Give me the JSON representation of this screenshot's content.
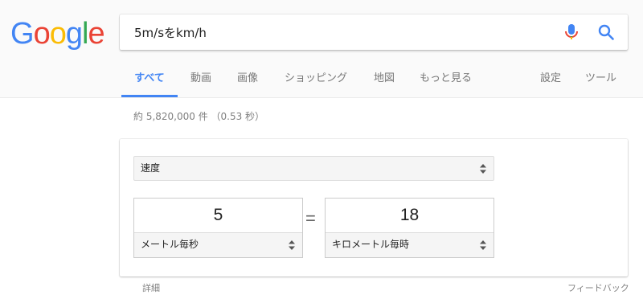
{
  "logo": {
    "text": "Google",
    "letters": [
      "G",
      "o",
      "o",
      "g",
      "l",
      "e"
    ],
    "colors": [
      "#4285f4",
      "#ea4335",
      "#fbbc05",
      "#4285f4",
      "#34a853",
      "#ea4335"
    ]
  },
  "search": {
    "query": "5m/sをkm/h",
    "mic_icon": "microphone-icon",
    "search_icon": "magnifier-icon"
  },
  "tabs": {
    "all": "すべて",
    "videos": "動画",
    "images": "画像",
    "shopping": "ショッピング",
    "maps": "地図",
    "more": "もっと見る",
    "settings": "設定",
    "tools": "ツール"
  },
  "result_stats": "約 5,820,000 件 （0.53 秒）",
  "converter": {
    "quantity": "速度",
    "from": {
      "value": "5",
      "unit": "メートル毎秒"
    },
    "equals": "=",
    "to": {
      "value": "18",
      "unit": "キロメートル毎時"
    }
  },
  "footer": {
    "details": "詳細",
    "feedback": "フィードバック"
  },
  "colors": {
    "accent": "#4285f4",
    "header_bg": "#fafafa"
  }
}
